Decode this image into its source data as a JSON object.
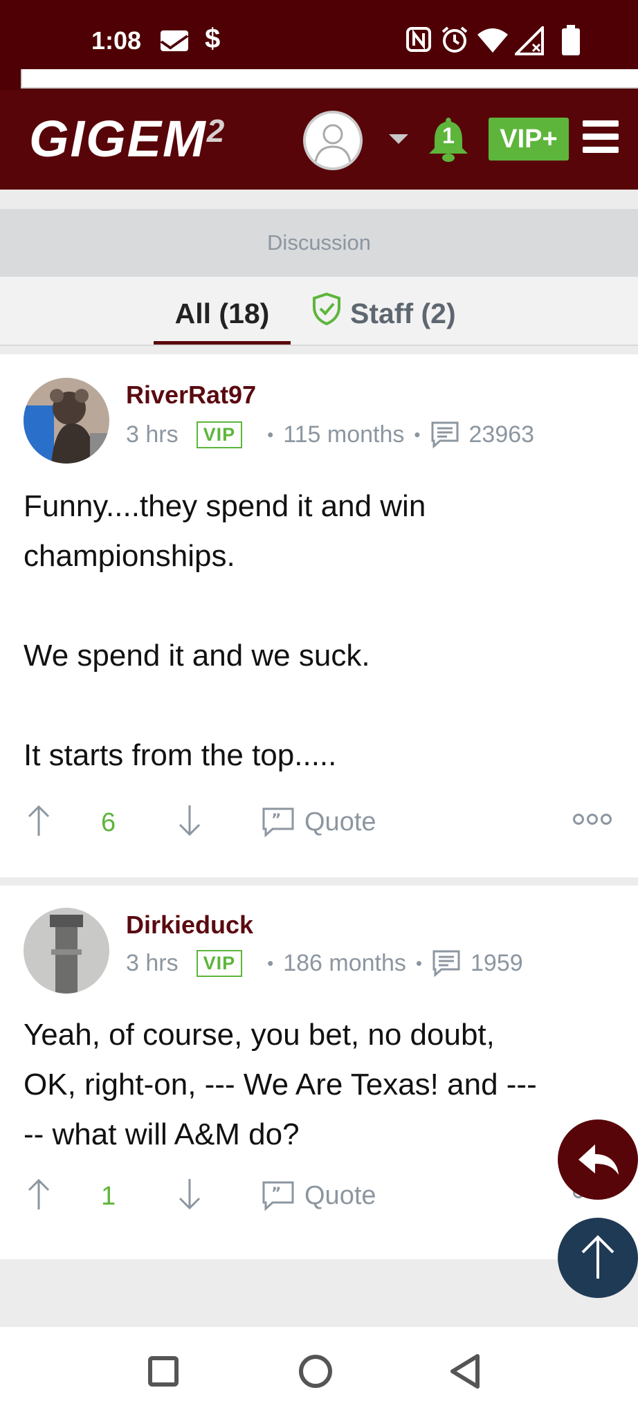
{
  "status_bar": {
    "time": "1:08",
    "icons": [
      "mail-icon",
      "dollar-icon",
      "nfc-icon",
      "alarm-icon",
      "wifi-icon",
      "signal-icon",
      "battery-icon"
    ]
  },
  "header": {
    "logo_text": "GIGEM",
    "logo_sup": "2",
    "notification_count": "1",
    "vip_plus_label": "VIP+",
    "colors": {
      "maroon": "#580509",
      "green": "#5db53b"
    }
  },
  "discussion": {
    "title": "Discussion",
    "tabs": [
      {
        "label": "All (18)",
        "active": true
      },
      {
        "label": "Staff (2)",
        "active": false
      }
    ]
  },
  "posts": [
    {
      "username": "RiverRat97",
      "time": "3 hrs",
      "badge": "VIP",
      "tenure": "115 months",
      "post_count": "23963",
      "body": [
        "Funny....they spend it and win",
        "championships.",
        "",
        "We spend it and we suck.",
        "",
        "It starts from the top....."
      ],
      "score": "6",
      "quote_label": "Quote"
    },
    {
      "username": "Dirkieduck",
      "time": "3 hrs",
      "badge": "VIP",
      "tenure": "186 months",
      "post_count": "1959",
      "body": [
        "Yeah, of course, you bet, no doubt,",
        "OK, right-on, --- We Are Texas! and ---",
        "-- what will A&M do?"
      ],
      "score": "1",
      "quote_label": "Quote"
    }
  ],
  "fabs": [
    "reply-icon",
    "arrow-up-icon"
  ],
  "nav": [
    "recents-icon",
    "home-icon",
    "back-icon"
  ]
}
